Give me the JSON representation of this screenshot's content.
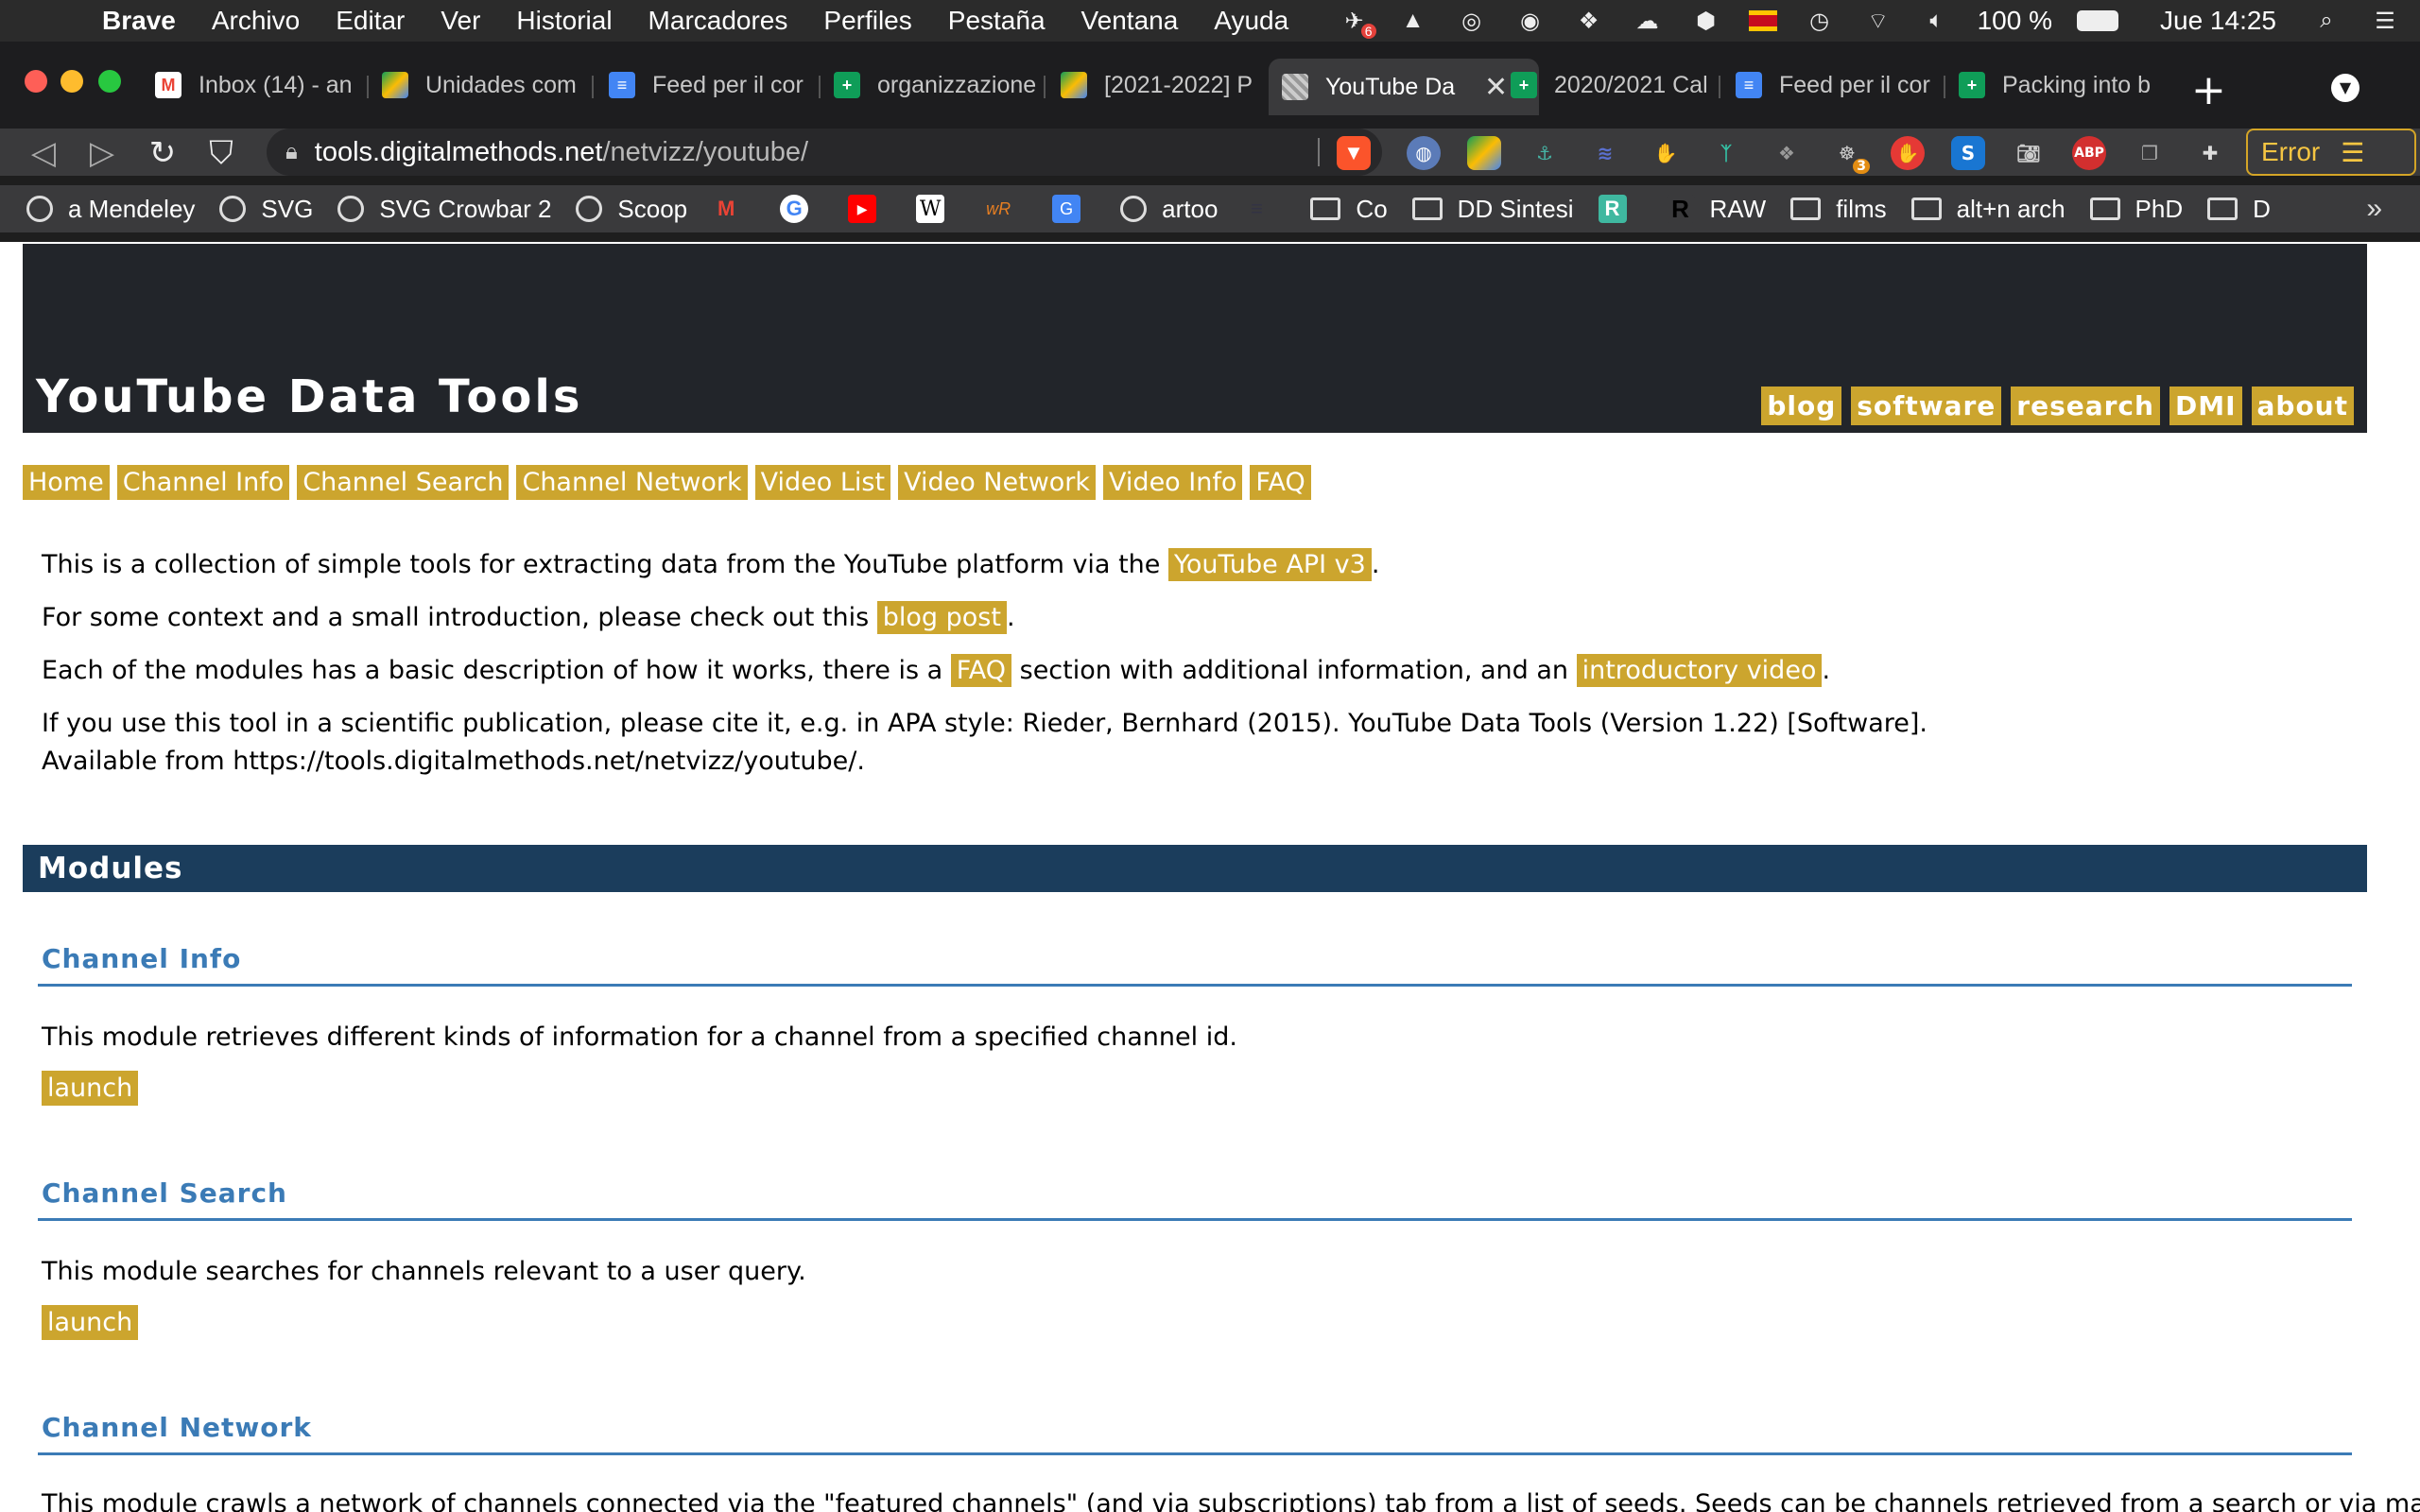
{
  "menubar": {
    "app_name": "Brave",
    "items": [
      "Archivo",
      "Editar",
      "Ver",
      "Historial",
      "Marcadores",
      "Perfiles",
      "Pestaña",
      "Ventana",
      "Ayuda"
    ],
    "notif_badge": "6",
    "battery": "100 %",
    "clock": "Jue 14:25"
  },
  "tabs": [
    {
      "title": "Inbox (14) - an",
      "icon": "gmail-icon"
    },
    {
      "title": "Unidades com",
      "icon": "drive-icon"
    },
    {
      "title": "Feed per il cor",
      "icon": "docs-icon"
    },
    {
      "title": "organizzazione",
      "icon": "sheets-icon"
    },
    {
      "title": "[2021-2022] P",
      "icon": "drive-icon"
    },
    {
      "title": "YouTube Da",
      "icon": "site-icon",
      "active": true
    },
    {
      "title": "2020/2021 Cal",
      "icon": "sheets-icon"
    },
    {
      "title": "Feed per il cor",
      "icon": "docs-icon"
    },
    {
      "title": "Packing into b",
      "icon": "sheets-icon"
    }
  ],
  "url": {
    "host": "tools.digitalmethods.net",
    "path": "/netvizz/youtube/"
  },
  "toolbar": {
    "error_label": "Error",
    "ext_badge": "3"
  },
  "bookmarks": [
    {
      "label": "a Mendeley",
      "icon": "globe"
    },
    {
      "label": "SVG",
      "icon": "globe"
    },
    {
      "label": "SVG Crowbar 2",
      "icon": "globe"
    },
    {
      "label": "Scoop",
      "icon": "globe"
    },
    {
      "label": "",
      "icon": "gmail"
    },
    {
      "label": "",
      "icon": "google"
    },
    {
      "label": "",
      "icon": "youtube"
    },
    {
      "label": "",
      "icon": "wikipedia"
    },
    {
      "label": "",
      "icon": "wr"
    },
    {
      "label": "",
      "icon": "translate"
    },
    {
      "label": "artoo",
      "icon": "globe"
    },
    {
      "label": "",
      "icon": "dark"
    },
    {
      "label": "Co",
      "icon": "folder"
    },
    {
      "label": "DD Sintesi",
      "icon": "folder"
    },
    {
      "label": "",
      "icon": "r-teal"
    },
    {
      "label": "RAW",
      "icon": "raw"
    },
    {
      "label": "films",
      "icon": "folder"
    },
    {
      "label": "alt+n arch",
      "icon": "folder"
    },
    {
      "label": "PhD",
      "icon": "folder"
    },
    {
      "label": "D",
      "icon": "folder"
    }
  ],
  "site": {
    "title": "YouTube Data Tools",
    "topnav": [
      "blog",
      "software",
      "research",
      "DMI",
      "about"
    ],
    "subnav": [
      "Home",
      "Channel Info",
      "Channel Search",
      "Channel Network",
      "Video List",
      "Video Network",
      "Video Info",
      "FAQ"
    ],
    "intro": {
      "p1_pre": "This is a collection of simple tools for extracting data from the YouTube platform via the ",
      "p1_link": "YouTube API v3",
      "p1_post": ".",
      "p2_pre": "For some context and a small introduction, please check out this ",
      "p2_link": "blog post",
      "p2_post": ".",
      "p3_pre": "Each of the modules has a basic description of how it works, there is a ",
      "p3_link1": "FAQ",
      "p3_mid": " section with additional information, and an ",
      "p3_link2": "introductory video",
      "p3_post": ".",
      "p4": "If you use this tool in a scientific publication, please cite it, e.g. in APA style: Rieder, Bernhard (2015). YouTube Data Tools (Version 1.22) [Software]. Available from https://tools.digitalmethods.net/netvizz/youtube/."
    },
    "modules_heading": "Modules",
    "modules": [
      {
        "title": "Channel Info",
        "desc": "This module retrieves different kinds of information for a channel from a specified channel id.",
        "launch": "launch"
      },
      {
        "title": "Channel Search",
        "desc": "This module searches for channels relevant to a user query.",
        "launch": "launch"
      },
      {
        "title": "Channel Network",
        "desc": "This module crawls a network of channels connected via the \"featured channels\" (and via subscriptions) tab from a list of seeds. Seeds can be channels retrieved from a search or via manual input."
      }
    ]
  }
}
